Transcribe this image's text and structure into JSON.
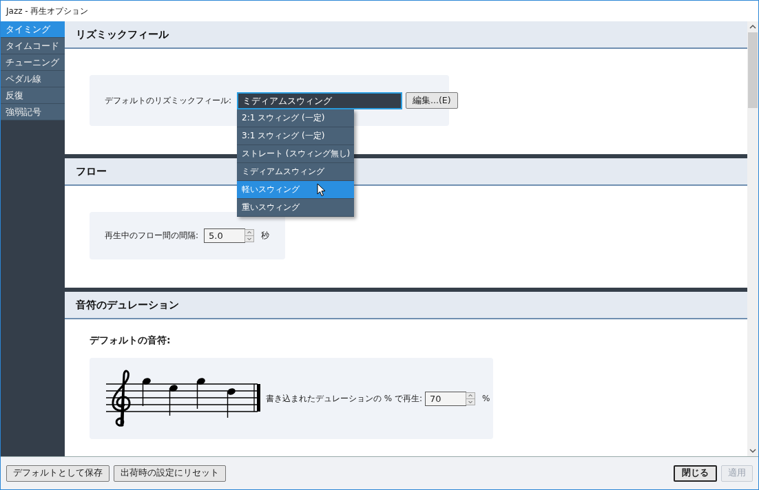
{
  "window": {
    "title": "Jazz - 再生オプション"
  },
  "sidebar": {
    "items": [
      {
        "label": "タイミング",
        "selected": true
      },
      {
        "label": "タイムコード",
        "selected": false
      },
      {
        "label": "チューニング",
        "selected": false
      },
      {
        "label": "ペダル線",
        "selected": false
      },
      {
        "label": "反復",
        "selected": false
      },
      {
        "label": "強弱記号",
        "selected": false
      }
    ]
  },
  "sections": [
    {
      "kind": "combo",
      "title": "リズミックフィール",
      "label": "デフォルトのリズミックフィール:",
      "value": "ミディアムスウィング",
      "button": "編集...(E)",
      "dropdown": [
        {
          "label": "2:1 スウィング (一定)",
          "highlighted": false
        },
        {
          "label": "3:1 スウィング (一定)",
          "highlighted": false
        },
        {
          "label": "ストレート (スウィング無し)",
          "highlighted": false
        },
        {
          "label": "ミディアムスウィング",
          "highlighted": false
        },
        {
          "label": "軽いスウィング",
          "highlighted": true
        },
        {
          "label": "重いスウィング",
          "highlighted": false
        }
      ]
    },
    {
      "kind": "spin",
      "title": "フロー",
      "label": "再生中のフロー間の間隔:",
      "value": "5.0",
      "unit": "秒"
    },
    {
      "kind": "notes",
      "title": "音符のデュレーション",
      "subheading": "デフォルトの音符:",
      "label": "書き込まれたデュレーションの % で再生:",
      "value": "70",
      "unit": "%"
    }
  ],
  "footer": {
    "left_buttons": [
      {
        "label": "デフォルトとして保存",
        "default": false,
        "disabled": false
      },
      {
        "label": "出荷時の設定にリセット",
        "default": false,
        "disabled": false
      }
    ],
    "right_buttons": [
      {
        "label": "閉じる",
        "default": true,
        "disabled": false
      },
      {
        "label": "適用",
        "default": false,
        "disabled": true
      }
    ]
  }
}
